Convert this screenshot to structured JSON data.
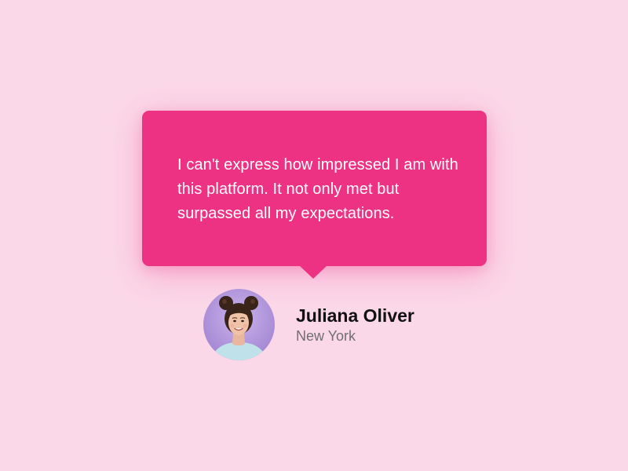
{
  "testimonial": {
    "quote": "I can't express how impressed I am with this platform. It not only met but surpassed all my expectations.",
    "author_name": "Juliana Oliver",
    "author_location": "New York"
  },
  "colors": {
    "background": "#fbd8e8",
    "bubble": "#ed3284",
    "quote_text": "#ffffff",
    "name_text": "#111111",
    "location_text": "#6f6f6f",
    "avatar_background": "#b99be0"
  },
  "icons": {
    "avatar": "avatar-photo"
  }
}
